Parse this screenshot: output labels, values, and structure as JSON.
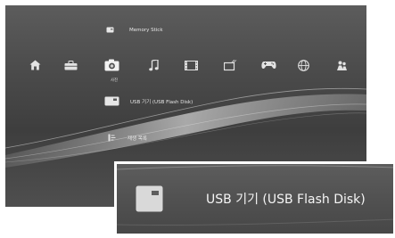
{
  "xmb": {
    "top_item": {
      "label": "Memory Stick",
      "icon": "memory-stick-icon"
    },
    "categories": [
      {
        "name": "home",
        "icon": "home-icon"
      },
      {
        "name": "toolbox",
        "icon": "toolbox-icon"
      },
      {
        "name": "photo",
        "icon": "camera-icon",
        "label": "사진"
      },
      {
        "name": "music",
        "icon": "music-note-icon"
      },
      {
        "name": "video",
        "icon": "film-icon"
      },
      {
        "name": "tv",
        "icon": "tv-icon"
      },
      {
        "name": "game",
        "icon": "gamepad-icon"
      },
      {
        "name": "network",
        "icon": "globe-icon"
      },
      {
        "name": "friends",
        "icon": "friends-icon"
      }
    ],
    "selected_category_label": "사진",
    "selected_item": {
      "label": "USB 기기 (USB Flash Disk)",
      "icon": "usb-device-icon"
    },
    "bottom_item": {
      "label": "재생 목록",
      "icon": "playlist-icon"
    }
  },
  "zoom": {
    "label": "USB 기기 (USB Flash Disk)",
    "icon": "usb-device-icon"
  },
  "colors": {
    "background": "#4a4a4a",
    "text": "#ededed",
    "frame": "#ffffff"
  }
}
